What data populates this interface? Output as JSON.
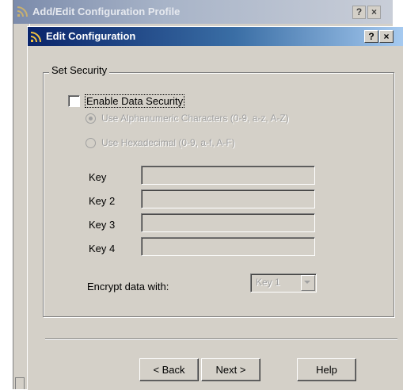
{
  "background_window": {
    "title": "Add/Edit Configuration Profile",
    "help_label": "?",
    "close_label": "×"
  },
  "dialog": {
    "title": "Edit Configuration",
    "help_label": "?",
    "close_label": "×"
  },
  "security": {
    "group_label": "Set Security",
    "enable_checkbox": {
      "label": "Enable Data Security",
      "checked": false
    },
    "radios": [
      {
        "label": "Use Alphanumeric Characters (0-9, a-z, A-Z)",
        "selected": true,
        "enabled": false
      },
      {
        "label": "Use Hexadecimal (0-9, a-f, A-F)",
        "selected": false,
        "enabled": false
      }
    ],
    "keys": [
      {
        "label": "Key",
        "value": ""
      },
      {
        "label": "Key 2",
        "value": ""
      },
      {
        "label": "Key 3",
        "value": ""
      },
      {
        "label": "Key 4",
        "value": ""
      }
    ],
    "encrypt_label": "Encrypt data with:",
    "encrypt_value": "Key 1"
  },
  "buttons": {
    "back": "< Back",
    "next": "Next >",
    "help": "Help"
  },
  "colors": {
    "title_active": "#0a246a",
    "title_inactive": "#7b8bab",
    "face": "#d4d0c8",
    "disabled_text": "#a0a0a0"
  }
}
